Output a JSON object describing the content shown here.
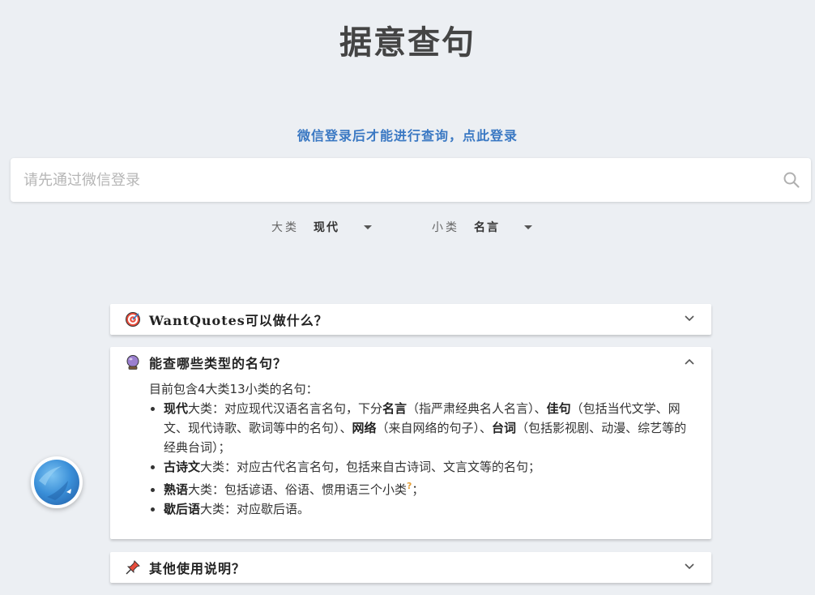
{
  "header": {
    "title": "据意查句"
  },
  "login": {
    "link_text": "微信登录后才能进行查询，点此登录"
  },
  "search": {
    "placeholder": "请先通过微信登录",
    "value": ""
  },
  "filters": {
    "major": {
      "label": "大类",
      "value": "现代"
    },
    "minor": {
      "label": "小类",
      "value": "名言"
    }
  },
  "panels": [
    {
      "title": "WantQuotes可以做什么？",
      "icon": "target-icon",
      "expanded": false
    },
    {
      "title": "能查哪些类型的名句？",
      "icon": "crystal-ball-icon",
      "expanded": true,
      "intro": "目前包含4大类13小类的名句：",
      "items": [
        {
          "b1": "现代",
          "t1": "大类：对应现代汉语名言名句，下分",
          "b2": "名言",
          "t2": "（指严肃经典名人名言）、",
          "b3": "佳句",
          "t3": "（包括当代文学、网文、现代诗歌、歌词等中的名句）、",
          "b4": "网络",
          "t4": "（来自网络的句子）、",
          "b5": "台词",
          "t5": "（包括影视剧、动漫、综艺等的经典台词）；"
        },
        {
          "b1": "古诗文",
          "t1": "大类：对应古代名言名句，包括来自古诗词、文言文等的名句；"
        },
        {
          "b1": "熟语",
          "t1": "大类：包括谚语、俗语、惯用语三个小类",
          "q": "?",
          "t2": "；"
        },
        {
          "b1": "歇后语",
          "t1": "大类：对应歇后语。"
        }
      ]
    },
    {
      "title": "其他使用说明？",
      "icon": "pushpin-icon",
      "expanded": false
    }
  ],
  "colors": {
    "accent": "#3a78c3",
    "background": "#eceff3",
    "hint": "#e6a23c"
  }
}
